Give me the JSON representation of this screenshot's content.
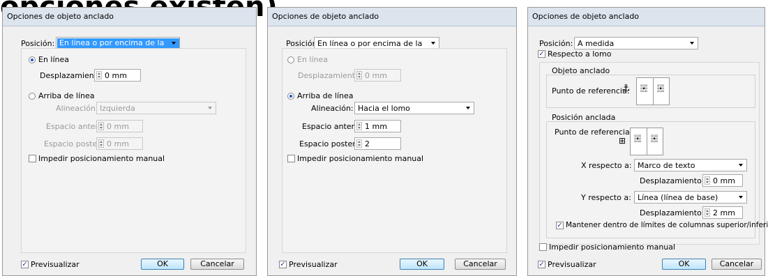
{
  "background_title": "opciones existen)",
  "dialog_title": "Opciones de objeto anclado",
  "dlg1": {
    "position_label": "Posición:",
    "position_value": "En línea o por encima de la línea",
    "inline_label": "En línea",
    "offset_y_label": "Desplazamiento Y:",
    "offset_y_value": "0 mm",
    "above_label": "Arriba de línea",
    "alignment_label": "Alineación:",
    "alignment_value": "Izquierda",
    "space_before_label": "Espacio anterior:",
    "space_before_value": "0 mm",
    "space_after_label": "Espacio posterior:",
    "space_after_value": "0 mm",
    "prevent_label": "Impedir posicionamiento manual",
    "preview_label": "Previsualizar",
    "ok_label": "OK",
    "cancel_label": "Cancelar"
  },
  "dlg2": {
    "position_label": "Posición:",
    "position_value": "En línea o por encima de la línea",
    "inline_label": "En línea",
    "offset_y_label": "Desplazamiento Y:",
    "offset_y_value": "0 mm",
    "above_label": "Arriba de línea",
    "alignment_label": "Alineación:",
    "alignment_value": "Hacia el lomo",
    "space_before_label": "Espacio anterior:",
    "space_before_value": "1 mm",
    "space_after_label": "Espacio posterior:",
    "space_after_value": "2",
    "prevent_label": "Impedir posicionamiento manual",
    "preview_label": "Previsualizar",
    "ok_label": "OK",
    "cancel_label": "Cancelar"
  },
  "dlg3": {
    "position_label": "Posición:",
    "position_value": "A medida",
    "relative_spine_label": "Respecto a lomo",
    "anchored_object_title": "Objeto anclado",
    "ref_point_label": "Punto de referencia:",
    "anchored_position_title": "Posición anclada",
    "ref_point_label2": "Punto de referencia:",
    "x_relative_label": "X respecto a:",
    "x_relative_value": "Marco de texto",
    "offset_x_label": "Desplazamiento X:",
    "offset_x_value": "0 mm",
    "y_relative_label": "Y respecto a:",
    "y_relative_value": "Línea (línea de base)",
    "offset_y_label": "Desplazamiento Y:",
    "offset_y_value": "2 mm",
    "keep_within_label": "Mantener dentro de límites de columnas superior/inferior",
    "prevent_label": "Impedir posicionamiento manual",
    "preview_label": "Previsualizar",
    "ok_label": "OK",
    "cancel_label": "Cancelar"
  }
}
